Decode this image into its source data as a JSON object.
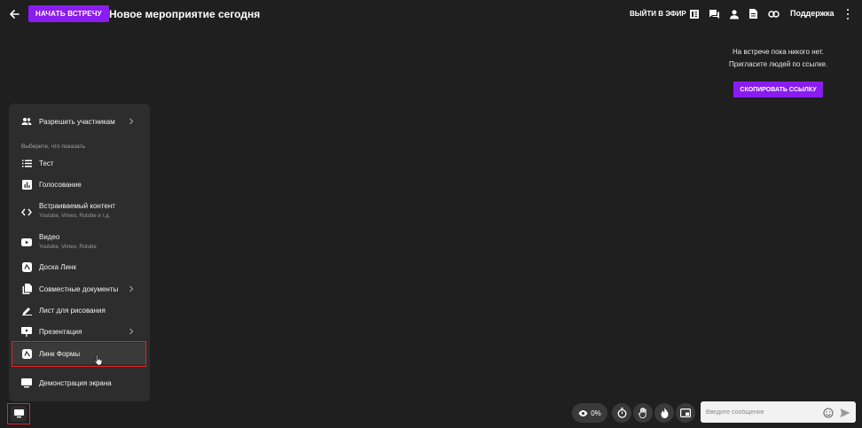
{
  "header": {
    "start_button": "НАЧАТЬ ВСТРЕЧУ",
    "title": "Новое мероприятие сегодня",
    "exit_air": "ВЫЙТИ В ЭФИР",
    "support": "Поддержка"
  },
  "empty_state": {
    "line1": "На встрече пока никого нет.",
    "line2": "Пригласите людей по ссылке.",
    "copy_link": "СКОПИРОВАТЬ ССЫЛКУ"
  },
  "menu": {
    "allow_participants": "Разрешить участникам",
    "section_label": "Выберите, что показать",
    "items": [
      {
        "label": "Тест",
        "icon": "list-icon"
      },
      {
        "label": "Голосование",
        "icon": "poll-icon"
      },
      {
        "label": "Встраиваемый контент",
        "sub": "Youtube, Vimeo, Rutube и т.д.",
        "icon": "code-icon"
      },
      {
        "label": "Видео",
        "sub": "Youtube, Vimeo, Rutube",
        "icon": "video-icon"
      },
      {
        "label": "Доска Линк",
        "icon": "board-icon"
      },
      {
        "label": "Совместные документы",
        "icon": "documents-icon"
      },
      {
        "label": "Лист для рисования",
        "icon": "pencil-icon"
      },
      {
        "label": "Презентация",
        "icon": "presentation-icon"
      },
      {
        "label": "Линк Формы",
        "icon": "forms-icon"
      },
      {
        "label": "Демонстрация экрана",
        "icon": "screen-icon"
      }
    ]
  },
  "bottom_bar": {
    "views_percent": "0%",
    "message_placeholder": "Введите сообщение"
  },
  "colors": {
    "accent": "#8a1cf0",
    "background": "#1f1f1f",
    "panel": "#2d2d2d",
    "highlight_border": "#e0242b"
  }
}
